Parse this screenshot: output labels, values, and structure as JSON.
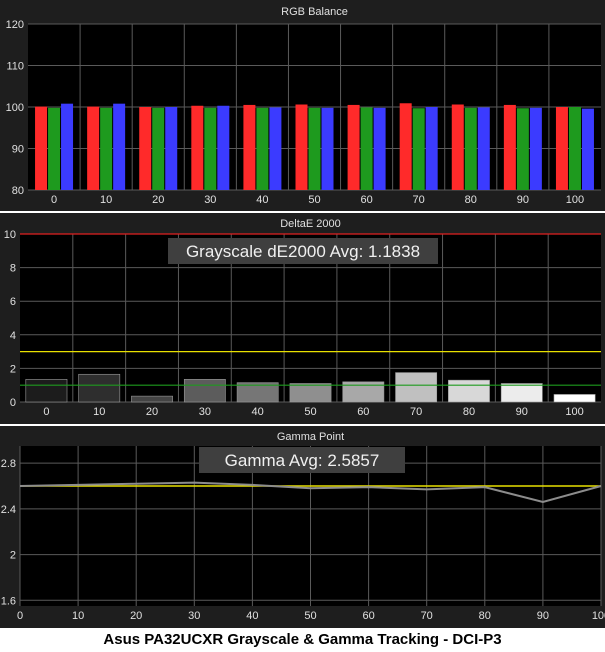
{
  "caption": "Asus PA32UCXR Grayscale & Gamma Tracking - DCI-P3",
  "colors": {
    "panel_bg": "#1e1e1e",
    "plot_bg": "#000000",
    "grid": "#5a5a5a",
    "text": "#e0e0e0",
    "red": "#ff2a2a",
    "green": "#1e9a1e",
    "blue": "#3b3bff",
    "deltae_limit": "#e02020",
    "deltae_visible": "#e8e000",
    "deltae_ideal": "#1e9a1e",
    "gamma_target": "#e8e000",
    "gamma_measured": "#8c8c8c"
  },
  "chart_data": [
    {
      "type": "bar",
      "title": "RGB Balance",
      "categories": [
        "0",
        "10",
        "20",
        "30",
        "40",
        "50",
        "60",
        "70",
        "80",
        "90",
        "100"
      ],
      "series": [
        {
          "color": "#ff2a2a",
          "values": [
            100.1,
            100.1,
            100.0,
            100.3,
            100.5,
            100.6,
            100.5,
            100.9,
            100.6,
            100.5,
            100.0
          ]
        },
        {
          "color": "#1e9a1e",
          "values": [
            99.8,
            99.8,
            99.8,
            99.8,
            99.8,
            99.8,
            99.9,
            99.7,
            99.8,
            99.7,
            100.0
          ]
        },
        {
          "color": "#3b3bff",
          "values": [
            100.8,
            100.8,
            100.0,
            100.3,
            99.9,
            99.8,
            99.8,
            100.0,
            99.9,
            99.8,
            99.6
          ]
        }
      ],
      "ylim": [
        80,
        120
      ],
      "yticks": [
        80,
        90,
        100,
        110,
        120
      ],
      "grid": true
    },
    {
      "type": "bar",
      "title": "DeltaE 2000",
      "annotation": "Grayscale dE2000 Avg: 1.1838",
      "categories": [
        "0",
        "10",
        "20",
        "30",
        "40",
        "50",
        "60",
        "70",
        "80",
        "90",
        "100"
      ],
      "values": [
        1.35,
        1.65,
        0.35,
        1.35,
        1.15,
        1.1,
        1.2,
        1.75,
        1.3,
        1.1,
        0.45
      ],
      "bar_colors": [
        "#1c1c1c",
        "#2e2e2e",
        "#444444",
        "#5c5c5c",
        "#767676",
        "#8f8f8f",
        "#a8a8a8",
        "#c0c0c0",
        "#d8d8d8",
        "#ececec",
        "#ffffff"
      ],
      "reference_lines": [
        {
          "value": 10,
          "color": "#e02020"
        },
        {
          "value": 3,
          "color": "#e8e000"
        },
        {
          "value": 1,
          "color": "#1e9a1e"
        }
      ],
      "ylim": [
        0,
        10
      ],
      "yticks": [
        0,
        2,
        4,
        6,
        8,
        10
      ],
      "grid": true
    },
    {
      "type": "line",
      "title": "Gamma Point",
      "annotation": "Gamma Avg: 2.5857",
      "x": [
        0,
        10,
        20,
        30,
        40,
        50,
        60,
        70,
        80,
        90,
        100
      ],
      "series": [
        {
          "color": "#e8e000",
          "values": [
            2.6,
            2.6,
            2.6,
            2.6,
            2.6,
            2.6,
            2.6,
            2.6,
            2.6,
            2.6,
            2.6
          ]
        },
        {
          "color": "#8c8c8c",
          "values": [
            2.6,
            2.61,
            2.62,
            2.63,
            2.61,
            2.58,
            2.59,
            2.57,
            2.59,
            2.46,
            2.6
          ]
        }
      ],
      "xlim": [
        0,
        100
      ],
      "xticks": [
        0,
        10,
        20,
        30,
        40,
        50,
        60,
        70,
        80,
        90,
        100
      ],
      "ylim": [
        1.55,
        2.95
      ],
      "yticks": [
        1.6,
        2,
        2.4,
        2.8
      ],
      "ytick_labels": [
        "1.6",
        "2",
        "2.4",
        "2.8"
      ],
      "grid": true
    }
  ]
}
